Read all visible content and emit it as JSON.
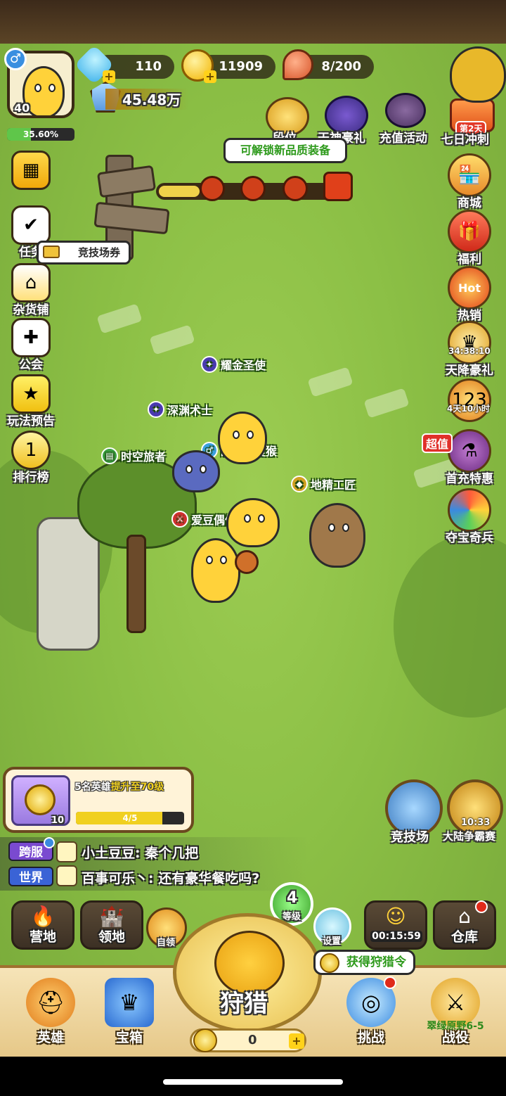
{
  "player": {
    "level": "40",
    "exp_percent": "35.60%",
    "exp_fraction": 0.356,
    "gender_icon": "male-icon",
    "power": "45.48万"
  },
  "resources": {
    "diamonds": "110",
    "gold": "11909",
    "stamina": "8/200"
  },
  "top_events": {
    "item1_label": "段位",
    "item2_label": "天神豪礼",
    "recharge_label": "充值活动",
    "seven_day_badge": "第2天",
    "seven_day_label": "七日冲刺"
  },
  "unlock_tooltip": "可解锁新品质装备",
  "arena_ticket_tooltip": "竞技场券",
  "left_menu": [
    {
      "label": "任务",
      "icon": "task-icon"
    },
    {
      "label": "杂货铺",
      "icon": "shop-stall-icon"
    },
    {
      "label": "公会",
      "icon": "guild-icon"
    },
    {
      "label": "玩法预告",
      "icon": "preview-icon"
    },
    {
      "label": "排行榜",
      "icon": "trophy-icon"
    }
  ],
  "right_menu": [
    {
      "label": "商城",
      "icon": "store-icon",
      "timer": ""
    },
    {
      "label": "福利",
      "icon": "gift-icon",
      "timer": ""
    },
    {
      "label": "热销",
      "icon": "hot-icon",
      "timer": "",
      "badge": "Hot"
    },
    {
      "label": "天降豪礼",
      "icon": "crown-gift-icon",
      "timer": "34:38:10"
    },
    {
      "label": "",
      "icon": "ranking-event-icon",
      "timer": "4天10小时"
    },
    {
      "label": "首充特惠",
      "icon": "first-charge-icon",
      "timer": "",
      "badge": "超值"
    },
    {
      "label": "夺宝奇兵",
      "icon": "treasure-wheel-icon",
      "timer": ""
    }
  ],
  "heroes": {
    "h1": "耀金圣使",
    "h2": "深渊术士",
    "h3": "战斗吧瘦猴",
    "h4": "时空旅者",
    "h5": "地精工匠",
    "h6": "爱豆偶像"
  },
  "quest": {
    "text_prefix": "5名英雄",
    "text_highlight": "提升至70级",
    "reward_count": "10",
    "progress": "4/5",
    "progress_fraction": 0.8
  },
  "arena": {
    "label": "竞技场",
    "conquest_label": "大陆争霸赛",
    "conquest_timer": "10:33"
  },
  "chat": [
    {
      "channel": "跨服",
      "message": "小土豆豆: 秦个几把",
      "color": "#7a4ad0"
    },
    {
      "channel": "世界",
      "message": "百事可乐丶: 还有豪华餐吃吗?",
      "color": "#3a63d6"
    }
  ],
  "nav_row": {
    "camp": "营地",
    "territory": "领地",
    "auto": "自领",
    "level_num": "4",
    "level_label": "等级",
    "settings": "设置",
    "timer": "00:15:59",
    "warehouse": "仓库"
  },
  "hunt_tooltip": "获得狩猎令",
  "bottom": {
    "hero": "英雄",
    "chest": "宝箱",
    "hunt": "狩猎",
    "hunt_count": "0",
    "challenge": "挑战",
    "campaign_stage": "翠绿原野6-5",
    "campaign": "战役"
  },
  "colors": {
    "grass": "#8bbf45",
    "gold": "#ffcf1a",
    "exp_bar": "#5fc64a",
    "ribbon_green": "#3a9a28"
  }
}
